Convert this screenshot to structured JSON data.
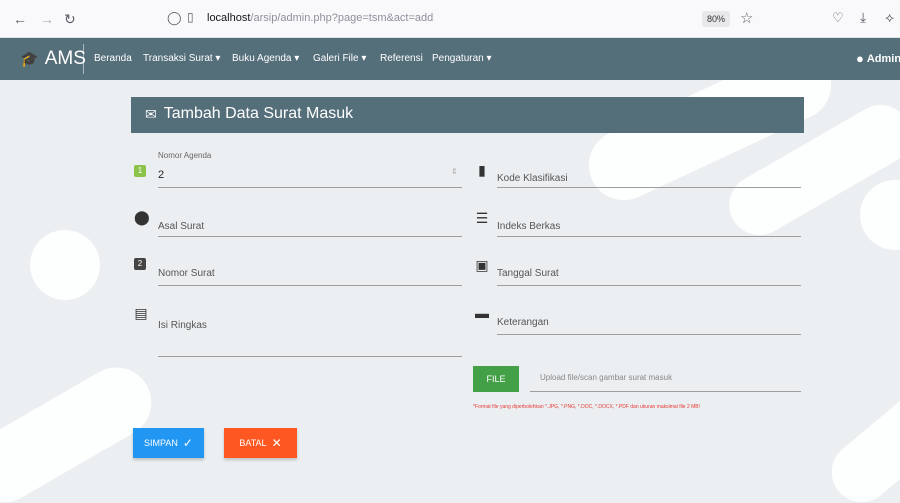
{
  "browser": {
    "url_host": "localhost",
    "url_path": "/arsip/admin.php?page=tsm&act=add",
    "zoom": "80%"
  },
  "navbar": {
    "brand": "AMS",
    "items": [
      "Beranda",
      "Transaksi Surat ▾",
      "Buku Agenda ▾",
      "Galeri File ▾",
      "Referensi",
      "Pengaturan ▾"
    ],
    "user": "Admin"
  },
  "form": {
    "title": "Tambah Data Surat Masuk",
    "nomor_agenda": {
      "label": "Nomor Agenda",
      "value": "2"
    },
    "kode_klasifikasi": {
      "label": "Kode Klasifikasi"
    },
    "asal_surat": {
      "label": "Asal Surat"
    },
    "indeks_berkas": {
      "label": "Indeks Berkas"
    },
    "nomor_surat": {
      "label": "Nomor Surat",
      "icon_text": "2"
    },
    "tanggal_surat": {
      "label": "Tanggal Surat"
    },
    "isi_ringkas": {
      "label": "Isi Ringkas"
    },
    "keterangan": {
      "label": "Keterangan"
    },
    "file": {
      "button": "FILE",
      "placeholder": "Upload file/scan gambar surat masuk",
      "note": "*Format file yang diperbolehkan *.JPG, *.PNG, *.DOC, *.DOCX, *.PDF dan ukuran maksimal file 2 MB!"
    },
    "buttons": {
      "simpan": "SIMPAN",
      "batal": "BATAL"
    }
  },
  "colors": {
    "navbar": "#546e7a",
    "simpan": "#2196f3",
    "batal": "#ff5722",
    "file": "#43a047",
    "note": "#e53935",
    "agenda_icon": "#8bc34a"
  }
}
